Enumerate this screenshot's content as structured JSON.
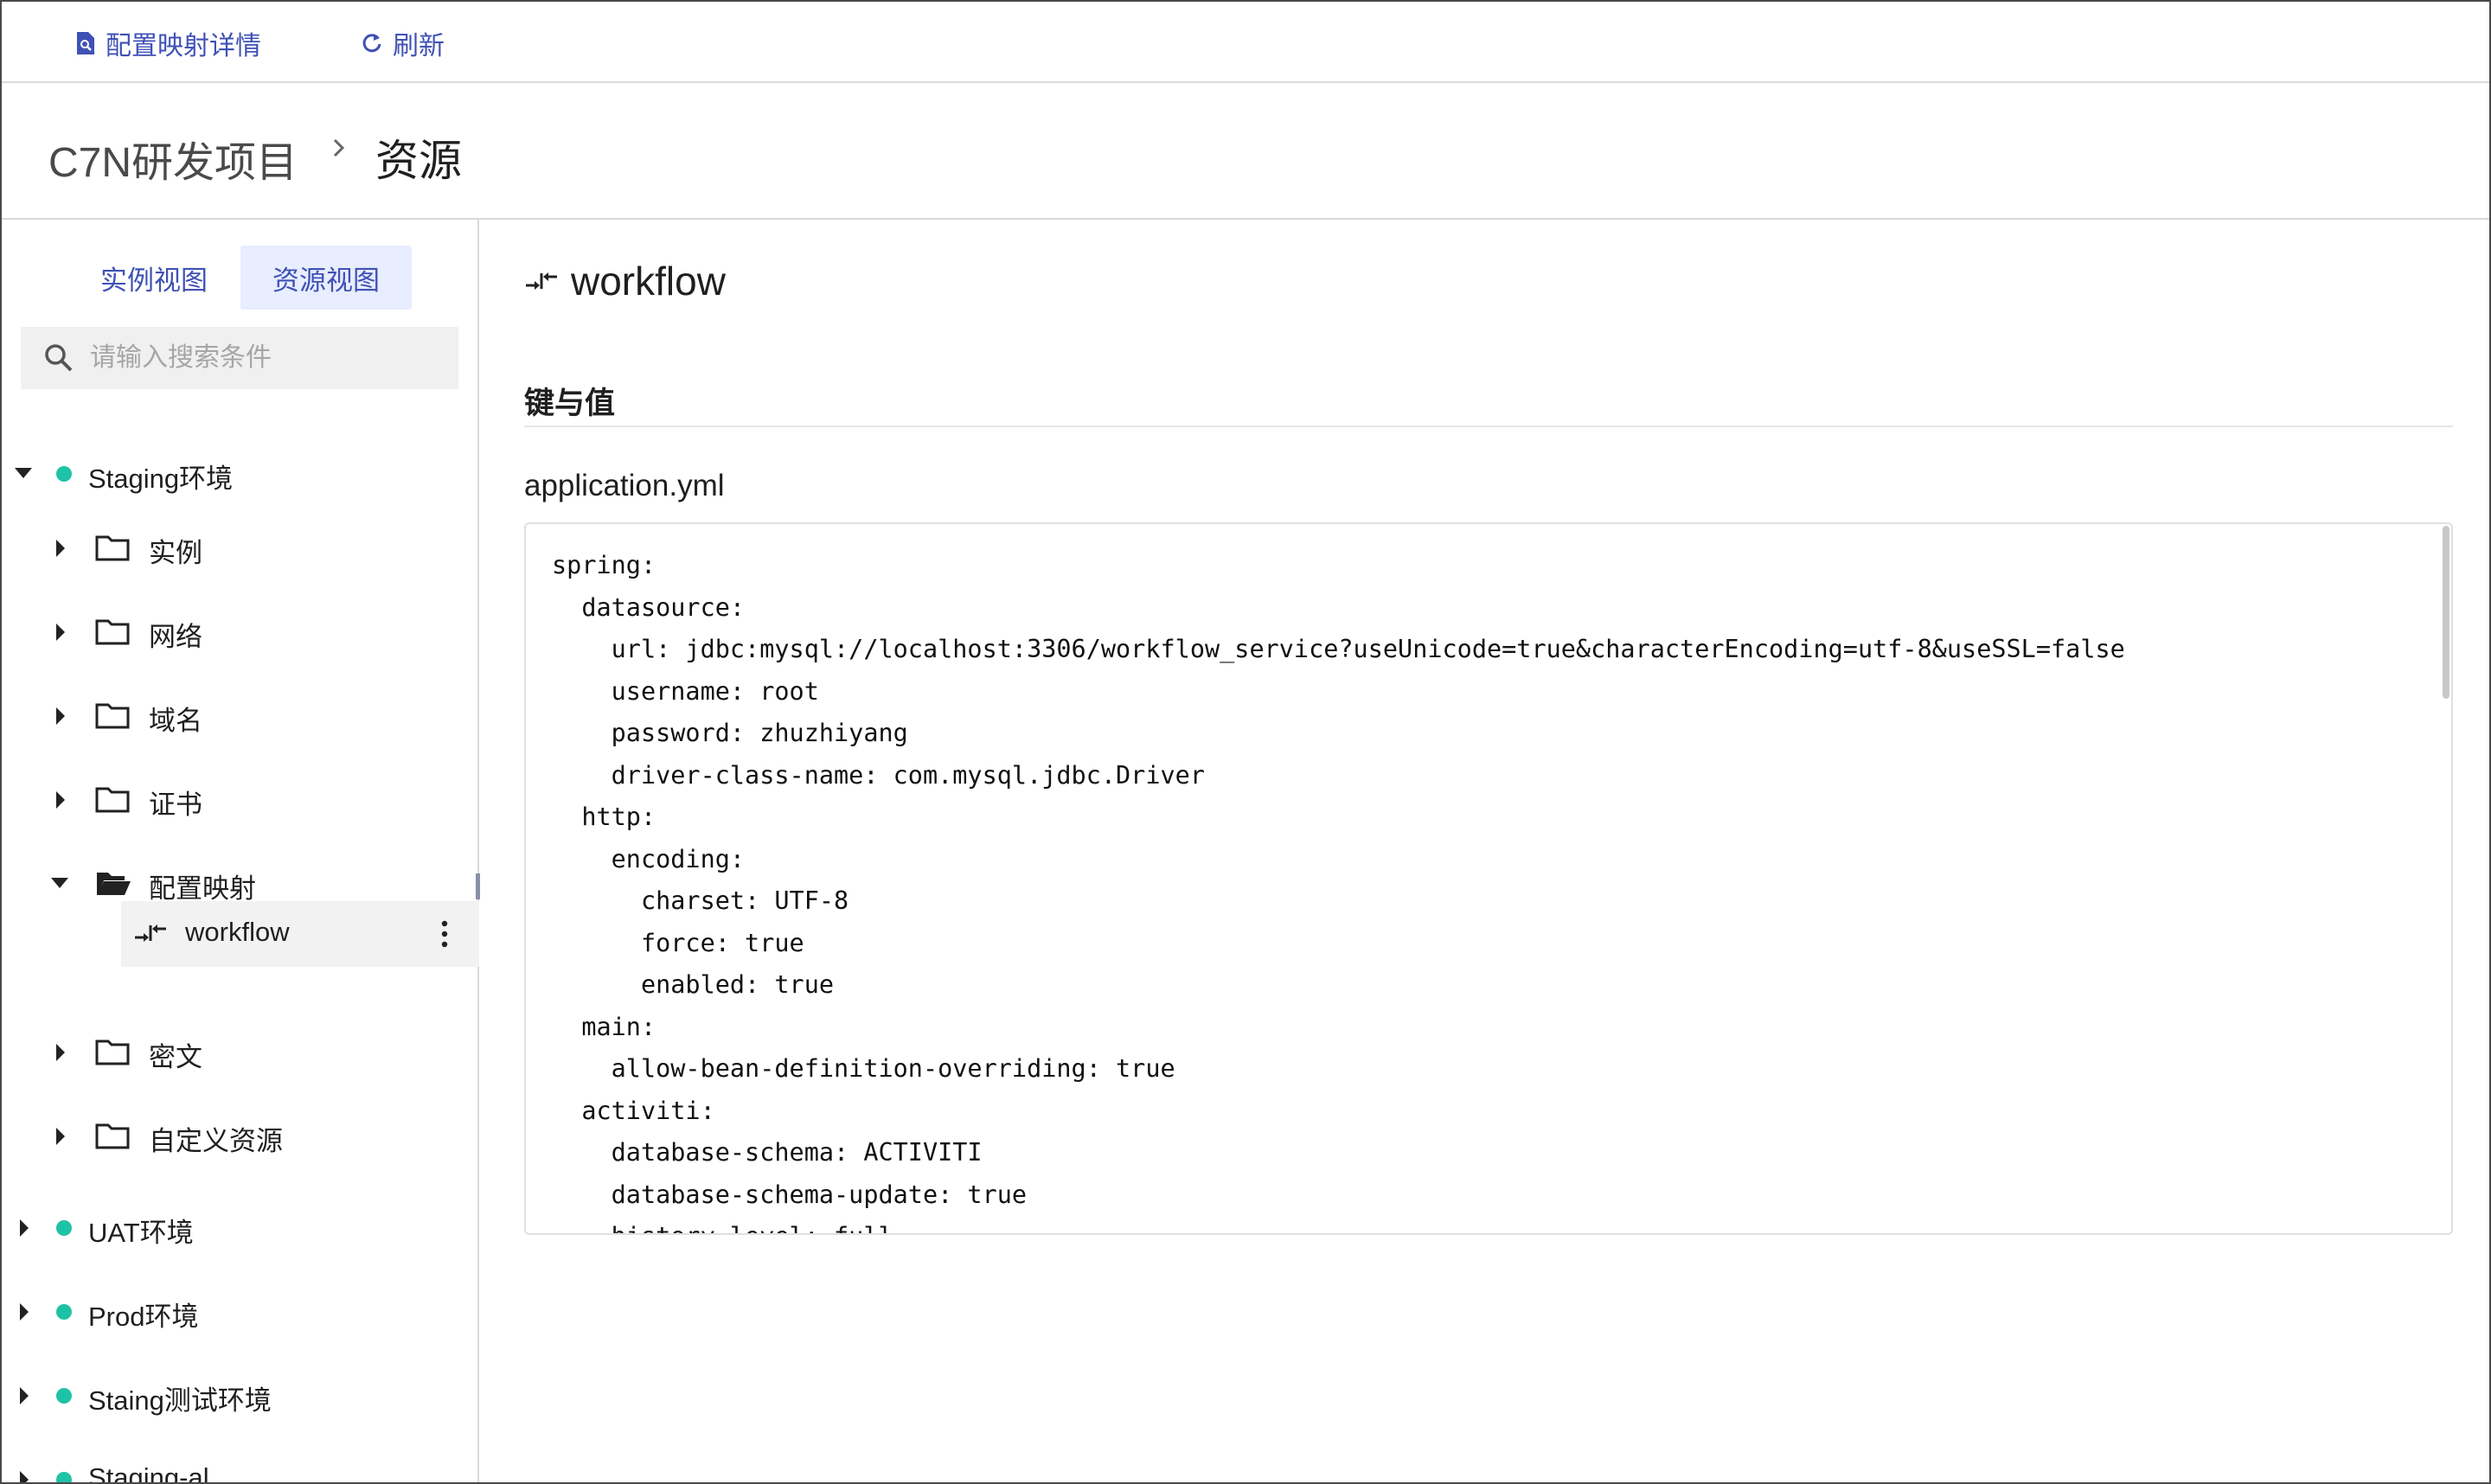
{
  "toolbar": {
    "detail_label": "配置映射详情",
    "refresh_label": "刷新"
  },
  "breadcrumb": {
    "project": "C7N研发项目",
    "current": "资源"
  },
  "sidebar": {
    "tabs": [
      {
        "label": "实例视图",
        "active": false
      },
      {
        "label": "资源视图",
        "active": true
      }
    ],
    "search_placeholder": "请输入搜索条件",
    "environments": [
      {
        "label": "Staging环境",
        "expanded": true,
        "folders": [
          {
            "label": "实例",
            "expanded": false
          },
          {
            "label": "网络",
            "expanded": false
          },
          {
            "label": "域名",
            "expanded": false
          },
          {
            "label": "证书",
            "expanded": false
          },
          {
            "label": "配置映射",
            "expanded": true,
            "children": [
              {
                "label": "workflow",
                "selected": true
              }
            ]
          },
          {
            "label": "密文",
            "expanded": false
          },
          {
            "label": "自定义资源",
            "expanded": false
          }
        ]
      },
      {
        "label": "UAT环境",
        "expanded": false
      },
      {
        "label": "Prod环境",
        "expanded": false
      },
      {
        "label": "Staing测试环境",
        "expanded": false
      },
      {
        "label": "Staging-al",
        "expanded": false
      }
    ],
    "status_color": "#1fc2a7"
  },
  "main": {
    "title": "workflow",
    "section_title": "键与值",
    "file_name": "application.yml",
    "code": "spring:\n  datasource:\n    url: jdbc:mysql://localhost:3306/workflow_service?useUnicode=true&characterEncoding=utf-8&useSSL=false\n    username: root\n    password: zhuzhiyang\n    driver-class-name: com.mysql.jdbc.Driver\n  http:\n    encoding:\n      charset: UTF-8\n      force: true\n      enabled: true\n  main:\n    allow-bean-definition-overriding: true\n  activiti:\n    database-schema: ACTIVITI\n    database-schema-update: true\n    history-level: full"
  },
  "colors": {
    "accent": "#3f51b5",
    "tab_active_bg": "#e8edff",
    "status_dot": "#1fc2a7"
  }
}
